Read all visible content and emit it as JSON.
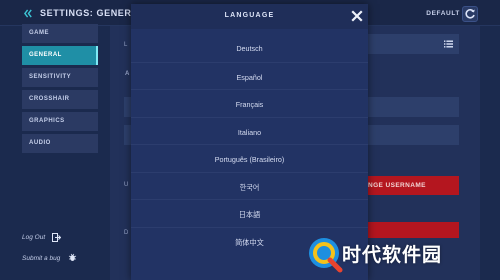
{
  "header": {
    "title": "SETTINGS: GENERAL",
    "default_label": "DEFAULT",
    "back_icon": "back-arrow-icon",
    "reset_icon": "refresh-icon"
  },
  "sidebar": {
    "items": [
      {
        "label": "GAME"
      },
      {
        "label": "GENERAL"
      },
      {
        "label": "SENSITIVITY"
      },
      {
        "label": "CROSSHAIR"
      },
      {
        "label": "GRAPHICS"
      },
      {
        "label": "AUDIO"
      }
    ],
    "active_index": 1,
    "logout_label": "Log Out",
    "bug_label": "Submit a bug"
  },
  "main": {
    "label_l": "L",
    "label_a": "A",
    "label_u": "U",
    "label_d": "D",
    "change_username_label": "NGE USERNAME"
  },
  "modal": {
    "title": "LANGUAGE",
    "close_icon": "close-icon",
    "languages": [
      "Deutsch",
      "Español",
      "Français",
      "Italiano",
      "Português (Brasileiro)",
      "한국어",
      "日本語",
      "简体中文"
    ]
  },
  "watermark": {
    "text": "时代软件园"
  },
  "colors": {
    "background": "#1b2a4e",
    "active_tab": "#1f8fa6",
    "modal": "#223364",
    "danger": "#b4161f"
  }
}
